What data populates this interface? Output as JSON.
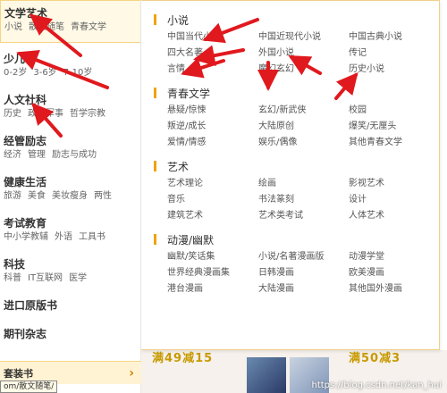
{
  "sidebar": {
    "categories": [
      {
        "title": "文学艺术",
        "subs": [
          "小说",
          "散文随笔",
          "青春文学"
        ]
      },
      {
        "title": "少儿",
        "subs": [
          "0-2岁",
          "3-6岁",
          "7-10岁"
        ]
      },
      {
        "title": "人文社科",
        "subs": [
          "历史",
          "政治军事",
          "哲学宗教"
        ]
      },
      {
        "title": "经管励志",
        "subs": [
          "经济",
          "管理",
          "励志与成功"
        ]
      },
      {
        "title": "健康生活",
        "subs": [
          "旅游",
          "美食",
          "美妆瘦身",
          "两性"
        ]
      },
      {
        "title": "考试教育",
        "subs": [
          "中小学教辅",
          "外语",
          "工具书"
        ]
      },
      {
        "title": "科技",
        "subs": [
          "科普",
          "IT互联网",
          "医学"
        ]
      },
      {
        "title": "进口原版书",
        "subs": []
      },
      {
        "title": "期刊杂志",
        "subs": []
      }
    ],
    "bottom": {
      "label": "套装书",
      "arrow": "›"
    },
    "tooltip": "om/散文随笔/"
  },
  "panel": {
    "groups": [
      {
        "title": "小说",
        "items": [
          "中国当代小说",
          "中国近现代小说",
          "中国古典小说",
          "四大名著",
          "外国小说",
          "传记",
          "言情",
          "魔幻玄幻",
          "历史小说"
        ]
      },
      {
        "title": "青春文学",
        "items": [
          "悬疑/惊悚",
          "玄幻/新武侠",
          "校园",
          "叛逆/成长",
          "大陆原创",
          "爆笑/无厘头",
          "爱情/情感",
          "娱乐/偶像",
          "其他青春文学"
        ]
      },
      {
        "title": "艺术",
        "items": [
          "艺术理论",
          "绘画",
          "影视艺术",
          "音乐",
          "书法篆刻",
          "设计",
          "建筑艺术",
          "艺术类考试",
          "人体艺术"
        ]
      },
      {
        "title": "动漫/幽默",
        "items": [
          "幽默/笑话集",
          "小说/名著漫画版",
          "动漫学堂",
          "世界经典漫画集",
          "日韩漫画",
          "欧美漫画",
          "港台漫画",
          "大陆漫画",
          "其他国外漫画"
        ]
      }
    ]
  },
  "banner": {
    "promo_left": "满49减15",
    "promo_right": "满50减3",
    "watermark": "https://blog.csdn.net/kan_hui"
  },
  "colors": {
    "accent": "#f0a30a",
    "arrow": "#e0191e"
  }
}
